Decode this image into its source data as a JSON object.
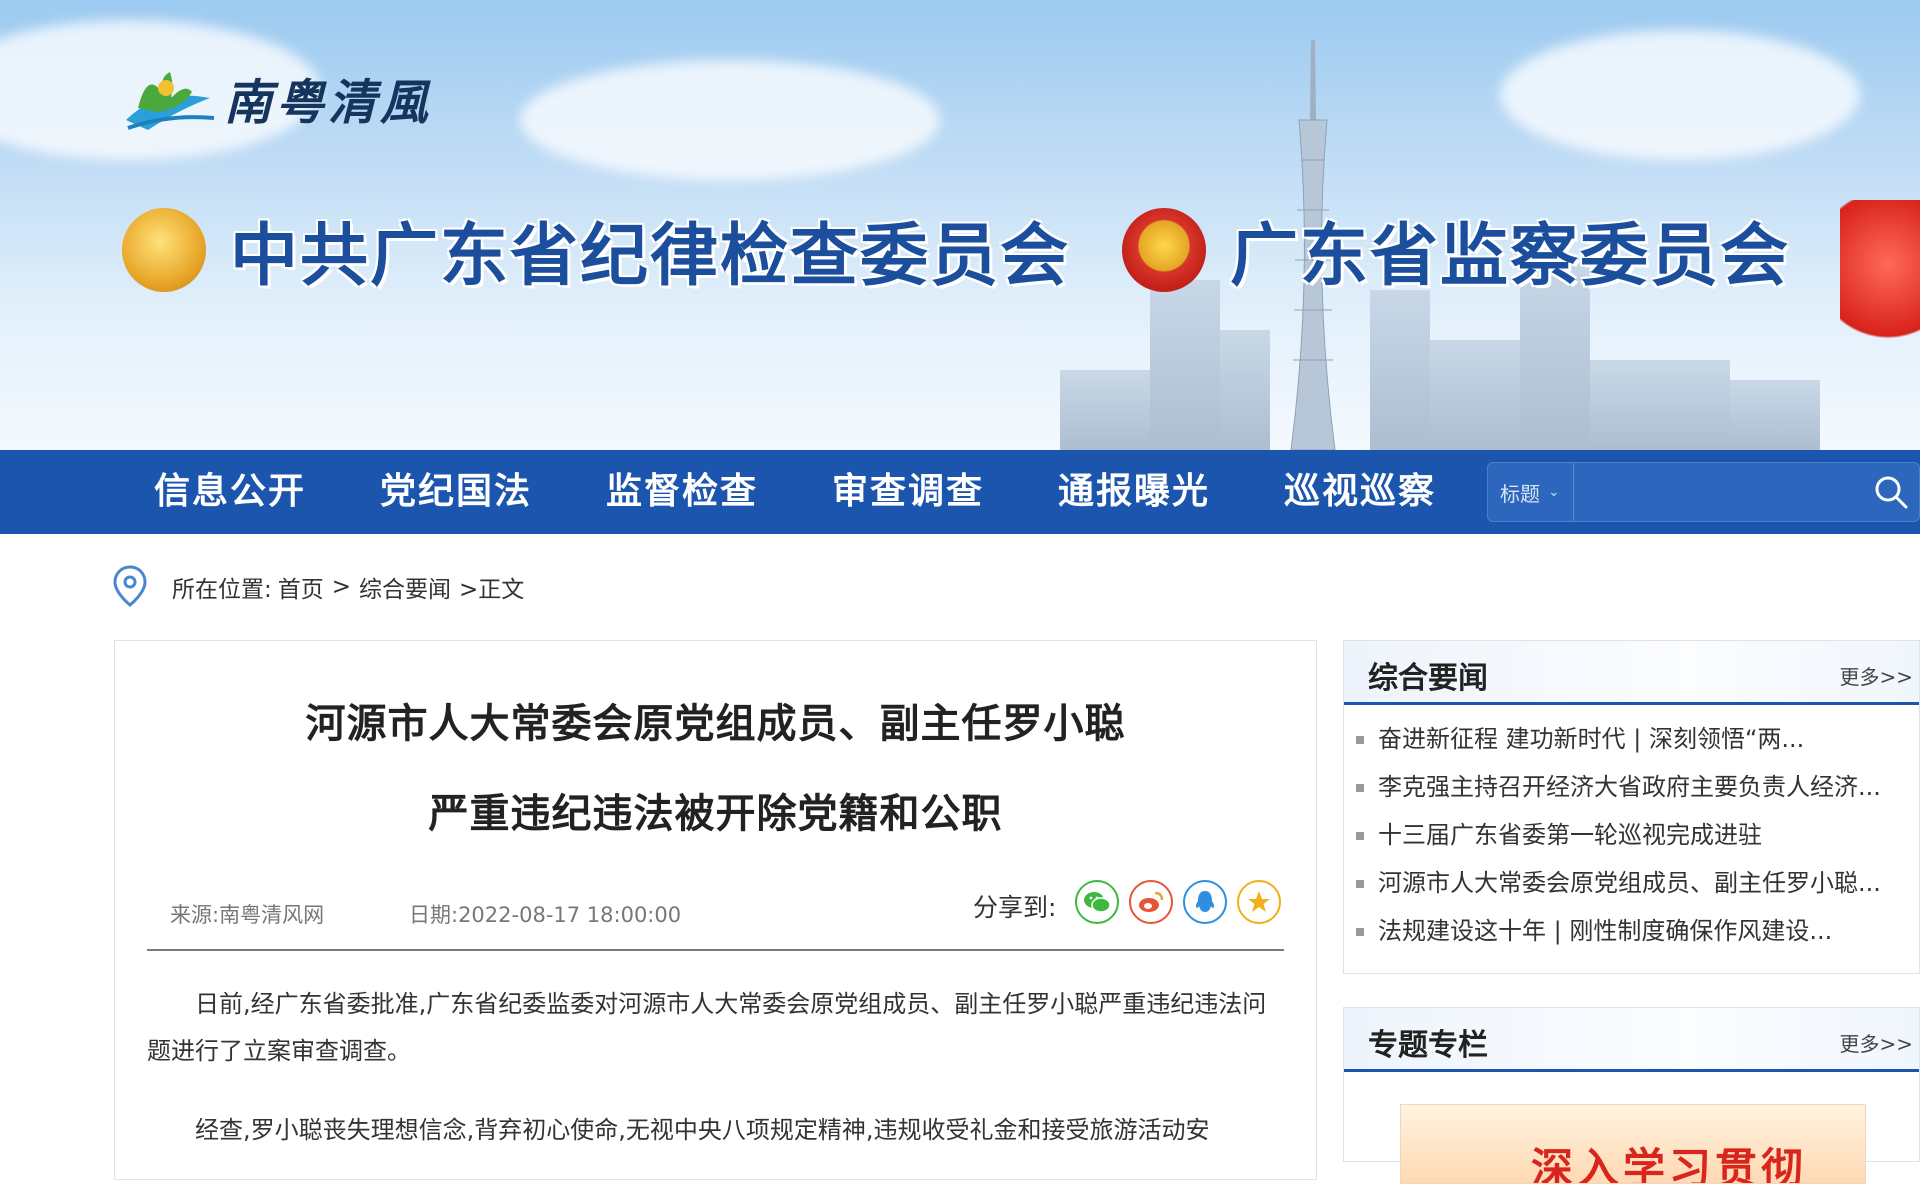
{
  "site": {
    "logo_text": "南粤清風",
    "title_left": "中共广东省纪律检查委员会",
    "title_right": "广东省监察委员会"
  },
  "nav": {
    "items": [
      "信息公开",
      "党纪国法",
      "监督检查",
      "审查调查",
      "通报曝光",
      "巡视巡察"
    ],
    "search_select": "标题",
    "search_placeholder": ""
  },
  "breadcrumb": {
    "label": "所在位置:",
    "home": "首页",
    "sep1": ">",
    "section": "综合要闻",
    "current": ">正文"
  },
  "article": {
    "title_line1": "河源市人大常委会原党组成员、副主任罗小聪",
    "title_line2": "严重违纪违法被开除党籍和公职",
    "source": "来源:南粤清风网",
    "date": "日期:2022-08-17 18:00:00",
    "share_label": "分享到:",
    "share_icons": [
      "wechat-icon",
      "weibo-icon",
      "qq-icon",
      "qzone-icon"
    ],
    "paragraph1": "日前,经广东省委批准,广东省纪委监委对河源市人大常委会原党组成员、副主任罗小聪严重违纪违法问题进行了立案审查调查。",
    "paragraph2": "经查,罗小聪丧失理想信念,背弃初心使命,无视中央八项规定精神,违规收受礼金和接受旅游活动安"
  },
  "sidebar": {
    "news": {
      "title": "综合要闻",
      "more": "更多>>",
      "items": [
        "奋进新征程 建功新时代 | 深刻领悟“两...",
        "李克强主持召开经济大省政府主要负责人经济...",
        "十三届广东省委第一轮巡视完成进驻",
        "河源市人大常委会原党组成员、副主任罗小聪...",
        "法规建设这十年 | 刚性制度确保作风建设..."
      ]
    },
    "special": {
      "title": "专题专栏",
      "more": "更多>>",
      "banner_text": "深入学习贯彻"
    }
  },
  "colors": {
    "nav_bg": "#1b55ad",
    "title_blue": "#1b4e9c",
    "wechat": "#3fb83f",
    "weibo": "#e8543a",
    "qq": "#2e8fe0",
    "qzone": "#f0b018"
  }
}
